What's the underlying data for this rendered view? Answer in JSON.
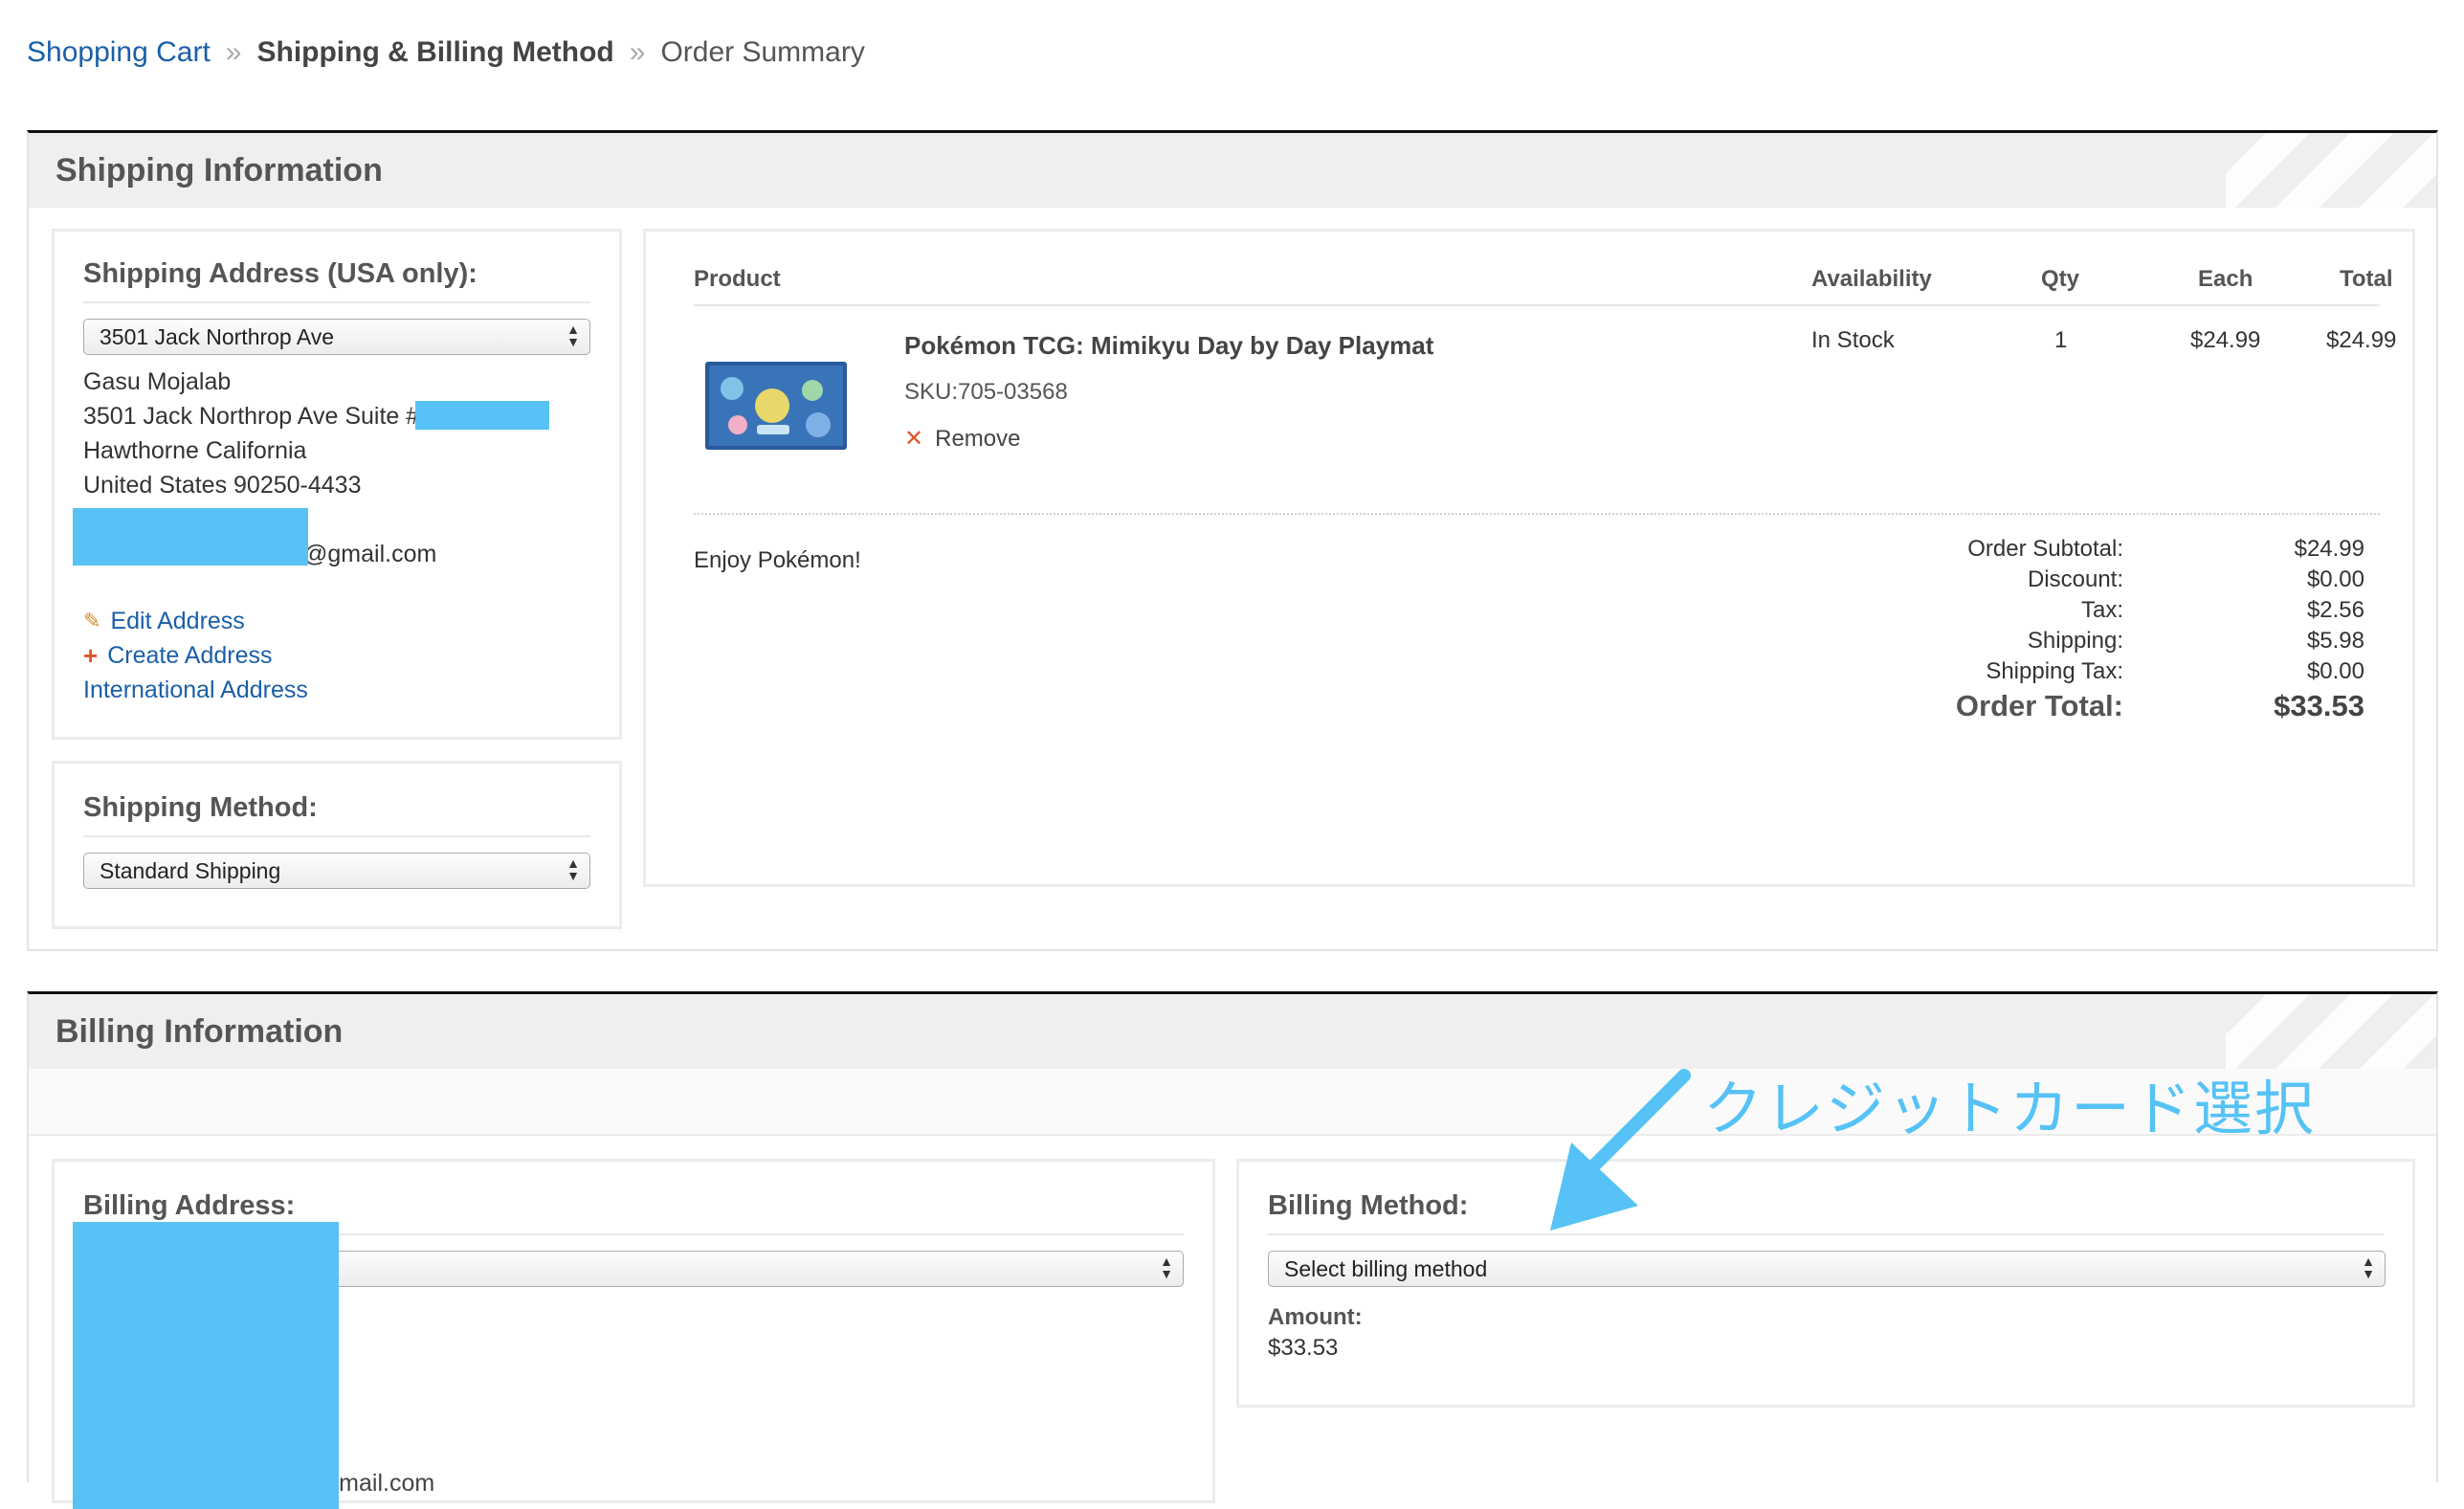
{
  "breadcrumb": {
    "step1": "Shopping Cart",
    "step2": "Shipping & Billing Method",
    "step3": "Order Summary",
    "separator": "»"
  },
  "shipping": {
    "section_title": "Shipping Information",
    "address_title": "Shipping Address (USA only):",
    "address_selected": "3501 Jack Northrop Ave",
    "name": "Gasu Mojalab",
    "street": "3501 Jack Northrop Ave Suite #",
    "city": "Hawthorne California",
    "country_zip": "United States 90250-4433",
    "email_suffix": "@gmail.com",
    "edit_address": "Edit Address",
    "create_address": "Create Address",
    "international_address": "International Address",
    "method_title": "Shipping Method:",
    "method_selected": "Standard Shipping"
  },
  "product_table": {
    "headers": {
      "product": "Product",
      "availability": "Availability",
      "qty": "Qty",
      "each": "Each",
      "total": "Total"
    },
    "item": {
      "name": "Pokémon TCG: Mimikyu Day by Day Playmat",
      "sku": "SKU:705-03568",
      "remove": "Remove",
      "availability": "In Stock",
      "qty": "1",
      "each": "$24.99",
      "total": "$24.99"
    },
    "note": "Enjoy Pokémon!"
  },
  "totals": {
    "subtotal_label": "Order Subtotal:",
    "subtotal": "$24.99",
    "discount_label": "Discount:",
    "discount": "$0.00",
    "tax_label": "Tax:",
    "tax": "$2.56",
    "shipping_label": "Shipping:",
    "shipping": "$5.98",
    "shipping_tax_label": "Shipping Tax:",
    "shipping_tax": "$0.00",
    "order_total_label": "Order Total:",
    "order_total": "$33.53"
  },
  "billing": {
    "section_title": "Billing Information",
    "address_title": "Billing Address:",
    "method_title": "Billing Method:",
    "method_placeholder": "Select billing method",
    "amount_label": "Amount:",
    "amount": "$33.53",
    "email_partial": "mojalabs.hazel.mojo@gmail.com"
  },
  "annotation": {
    "text": "クレジットカード選択",
    "color": "#56c2f6"
  }
}
